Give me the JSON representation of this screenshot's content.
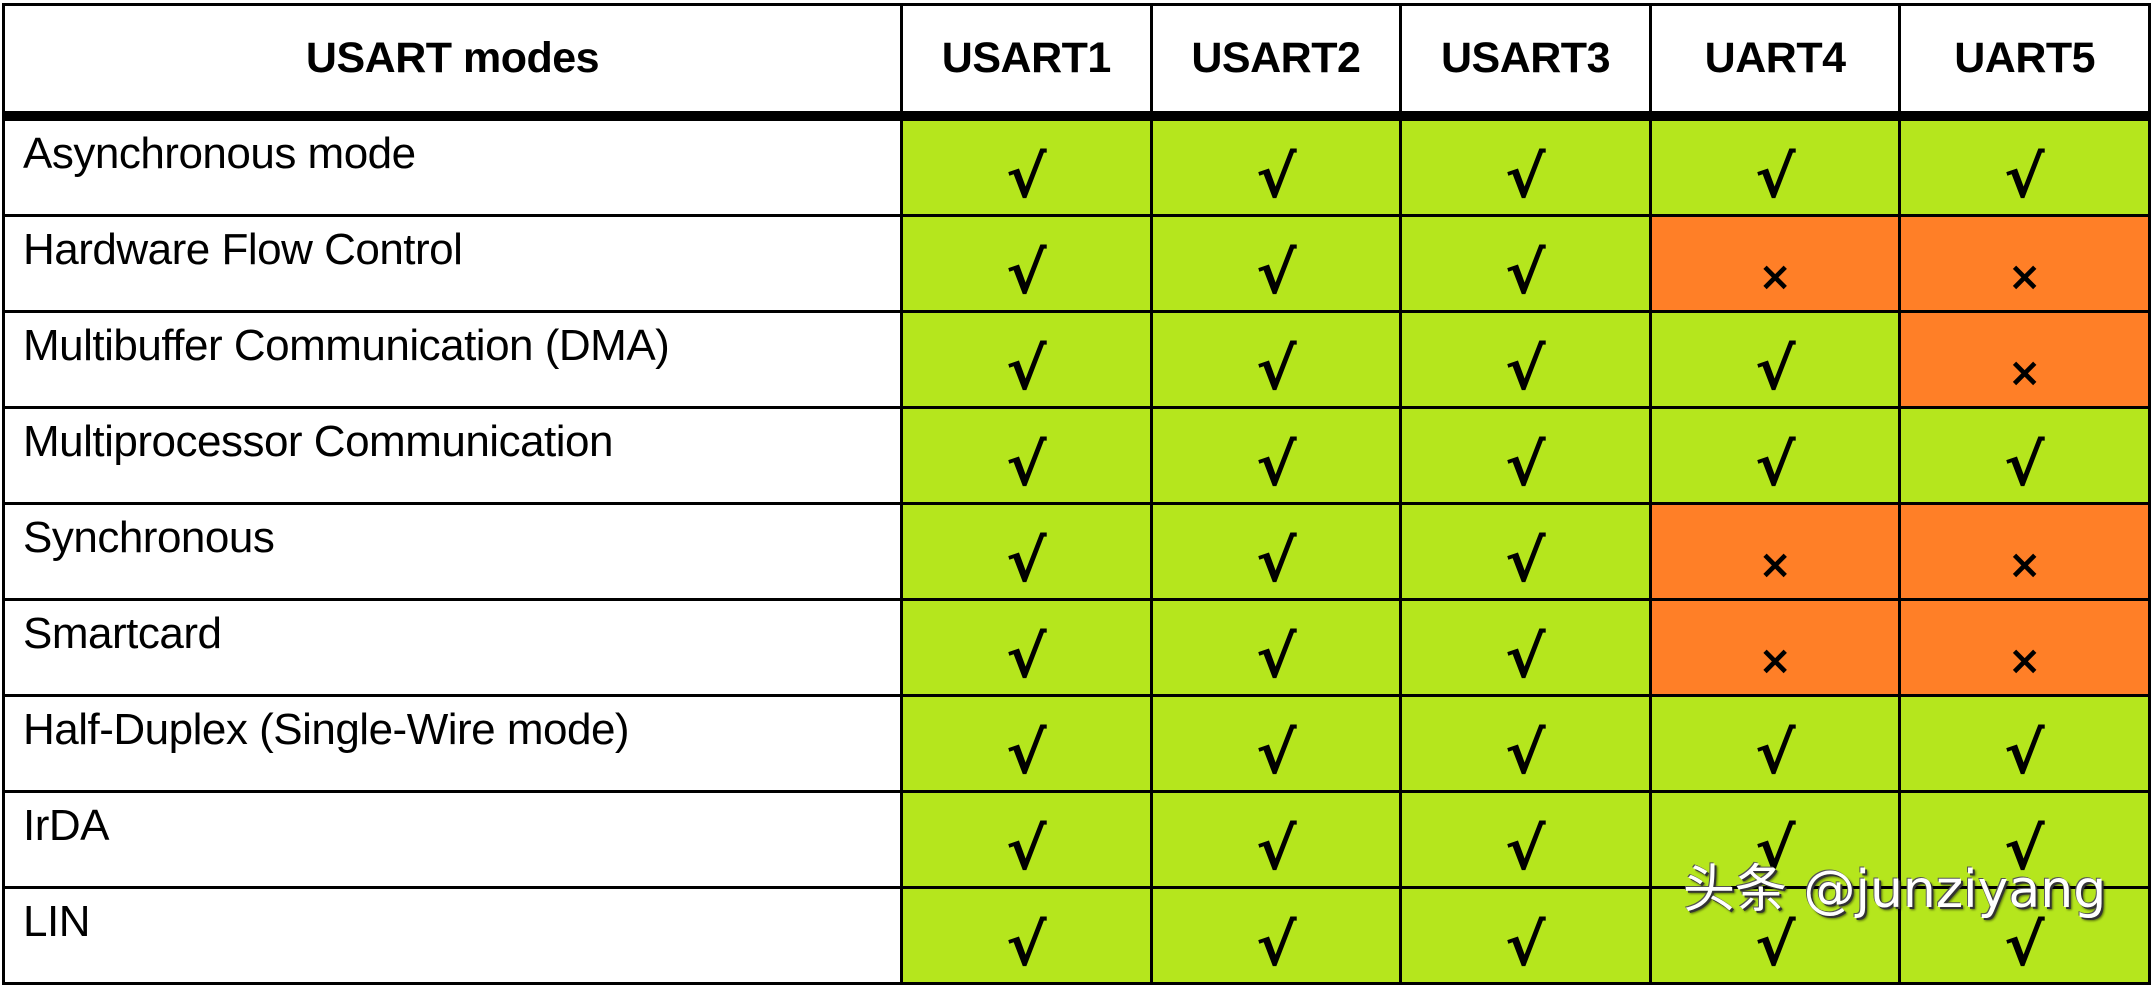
{
  "table": {
    "header": {
      "mode_column": "USART modes",
      "peripherals": [
        "USART1",
        "USART2",
        "USART3",
        "UART4",
        "UART5"
      ]
    },
    "symbols": {
      "supported": "√",
      "unsupported": "×"
    },
    "colors": {
      "supported_bg": "#b5e61d",
      "unsupported_bg": "#ff7f27"
    },
    "rows": [
      {
        "mode": "Asynchronous mode",
        "support": [
          true,
          true,
          true,
          true,
          true
        ]
      },
      {
        "mode": "Hardware Flow Control",
        "support": [
          true,
          true,
          true,
          false,
          false
        ]
      },
      {
        "mode": "Multibuffer Communication (DMA)",
        "support": [
          true,
          true,
          true,
          true,
          false
        ]
      },
      {
        "mode": "Multiprocessor Communication",
        "support": [
          true,
          true,
          true,
          true,
          true
        ]
      },
      {
        "mode": "Synchronous",
        "support": [
          true,
          true,
          true,
          false,
          false
        ]
      },
      {
        "mode": "Smartcard",
        "support": [
          true,
          true,
          true,
          false,
          false
        ]
      },
      {
        "mode": "Half-Duplex (Single-Wire mode)",
        "support": [
          true,
          true,
          true,
          true,
          true
        ]
      },
      {
        "mode": "IrDA",
        "support": [
          true,
          true,
          true,
          true,
          true
        ]
      },
      {
        "mode": "LIN",
        "support": [
          true,
          true,
          true,
          true,
          true
        ]
      }
    ]
  },
  "watermark": "头条 @junziyang"
}
